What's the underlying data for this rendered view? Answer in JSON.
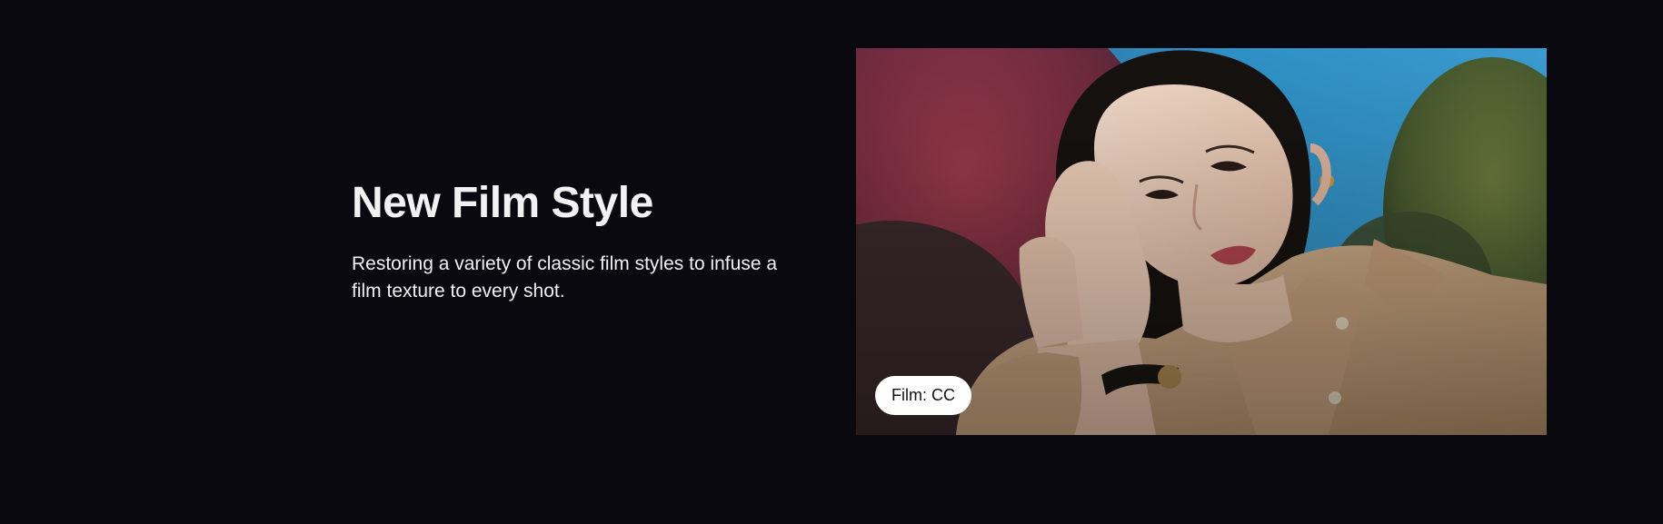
{
  "feature": {
    "title": "New Film Style",
    "description": "Restoring a variety of classic film styles to infuse a film texture to every shot.",
    "photo_badge": "Film: CC"
  },
  "colors": {
    "page_background": "#0a0910",
    "text": "#f2f2f4",
    "badge_background": "#ffffff",
    "badge_text": "#111111"
  }
}
